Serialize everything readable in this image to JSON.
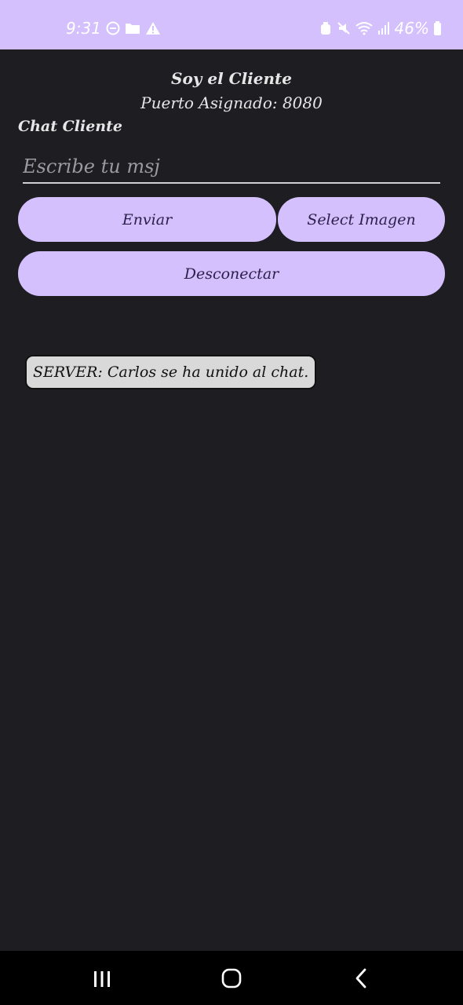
{
  "status_bar": {
    "time": "9:31",
    "battery": "46%",
    "icons": [
      "do-not-disturb-icon",
      "folder-icon",
      "warning-icon",
      "alarm-icon",
      "mute-icon",
      "wifi-icon",
      "signal-icon",
      "battery-icon"
    ],
    "background": "#d4c0fd"
  },
  "header": {
    "title": "Soy el Cliente",
    "port": "Puerto Asignado: 8080"
  },
  "chat": {
    "label": "Chat Cliente",
    "input_placeholder": "Escribe tu msj",
    "input_value": ""
  },
  "buttons": {
    "send": "Enviar",
    "select_image": "Select Imagen",
    "disconnect": "Desconectar"
  },
  "messages": [
    {
      "text": "SERVER: Carlos se ha unido al chat."
    }
  ],
  "nav_bar": {
    "icons": [
      "recents-icon",
      "home-icon",
      "back-icon"
    ]
  },
  "colors": {
    "accent": "#d4c0fd",
    "background": "#1e1d22",
    "button_text": "#2a1f4a",
    "bubble": "#d9d9d9"
  }
}
